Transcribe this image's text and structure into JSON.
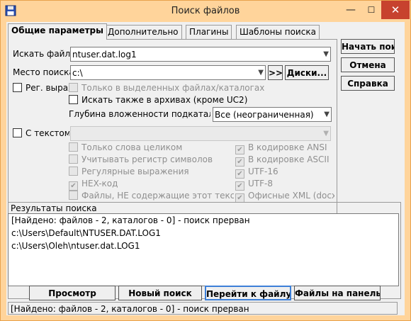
{
  "window": {
    "title": "Поиск файлов",
    "minimize": "—",
    "maximize": "☐",
    "close": "✕"
  },
  "tabs": [
    "Общие параметры",
    "Дополнительно",
    "Плагины",
    "Шаблоны поиска"
  ],
  "search_for": {
    "label": "Искать файлы:",
    "value": "ntuser.dat.log1"
  },
  "search_in": {
    "label": "Место поиска:",
    "value": "c:\\",
    "browse": ">>",
    "drives": "Диски..."
  },
  "regex_option": {
    "label": "Рег. выражения",
    "checked": false
  },
  "only_selected": {
    "label": "Только в выделенных файлах/каталогах",
    "checked": false,
    "enabled": false
  },
  "search_archives": {
    "label": "Искать также в архивах (кроме UC2)",
    "checked": false
  },
  "depth": {
    "label": "Глубина вложенности подкаталогов:",
    "value": "Все (неограниченная)"
  },
  "with_text": {
    "label": "С текстом:",
    "value": "",
    "checked": false
  },
  "text_options_left": [
    {
      "label": "Только слова целиком",
      "checked": false
    },
    {
      "label": "Учитывать регистр символов",
      "checked": false
    },
    {
      "label": "Регулярные выражения",
      "checked": false
    },
    {
      "label": "HEX-код",
      "checked": true
    },
    {
      "label": "Файлы, НЕ содержащие этот текст",
      "checked": false
    }
  ],
  "text_options_right": [
    {
      "label": "В кодировке ANSI",
      "checked": true
    },
    {
      "label": "В кодировке ASCII",
      "checked": true
    },
    {
      "label": "UTF-16",
      "checked": true
    },
    {
      "label": "UTF-8",
      "checked": true
    },
    {
      "label": "Офисные XML (docx)",
      "checked": true
    }
  ],
  "side_buttons": {
    "start": "Начать поиск",
    "cancel": "Отмена",
    "help": "Справка"
  },
  "results": {
    "title": "Результаты поиска",
    "lines": [
      "[Найдено: файлов - 2, каталогов - 0] - поиск прерван",
      "c:\\Users\\Default\\NTUSER.DAT.LOG1",
      "c:\\Users\\Oleh\\ntuser.dat.LOG1"
    ]
  },
  "bottom_buttons": {
    "view": "Просмотр",
    "new_search": "Новый поиск",
    "goto_file": "Перейти к файлу",
    "to_panel": "Файлы на панель"
  },
  "status": "[Найдено: файлов - 2, каталогов - 0] - поиск прерван",
  "colors": {
    "titlebar": "#ffd49b",
    "close": "#c7422e",
    "dialog": "#f0f0f0"
  }
}
